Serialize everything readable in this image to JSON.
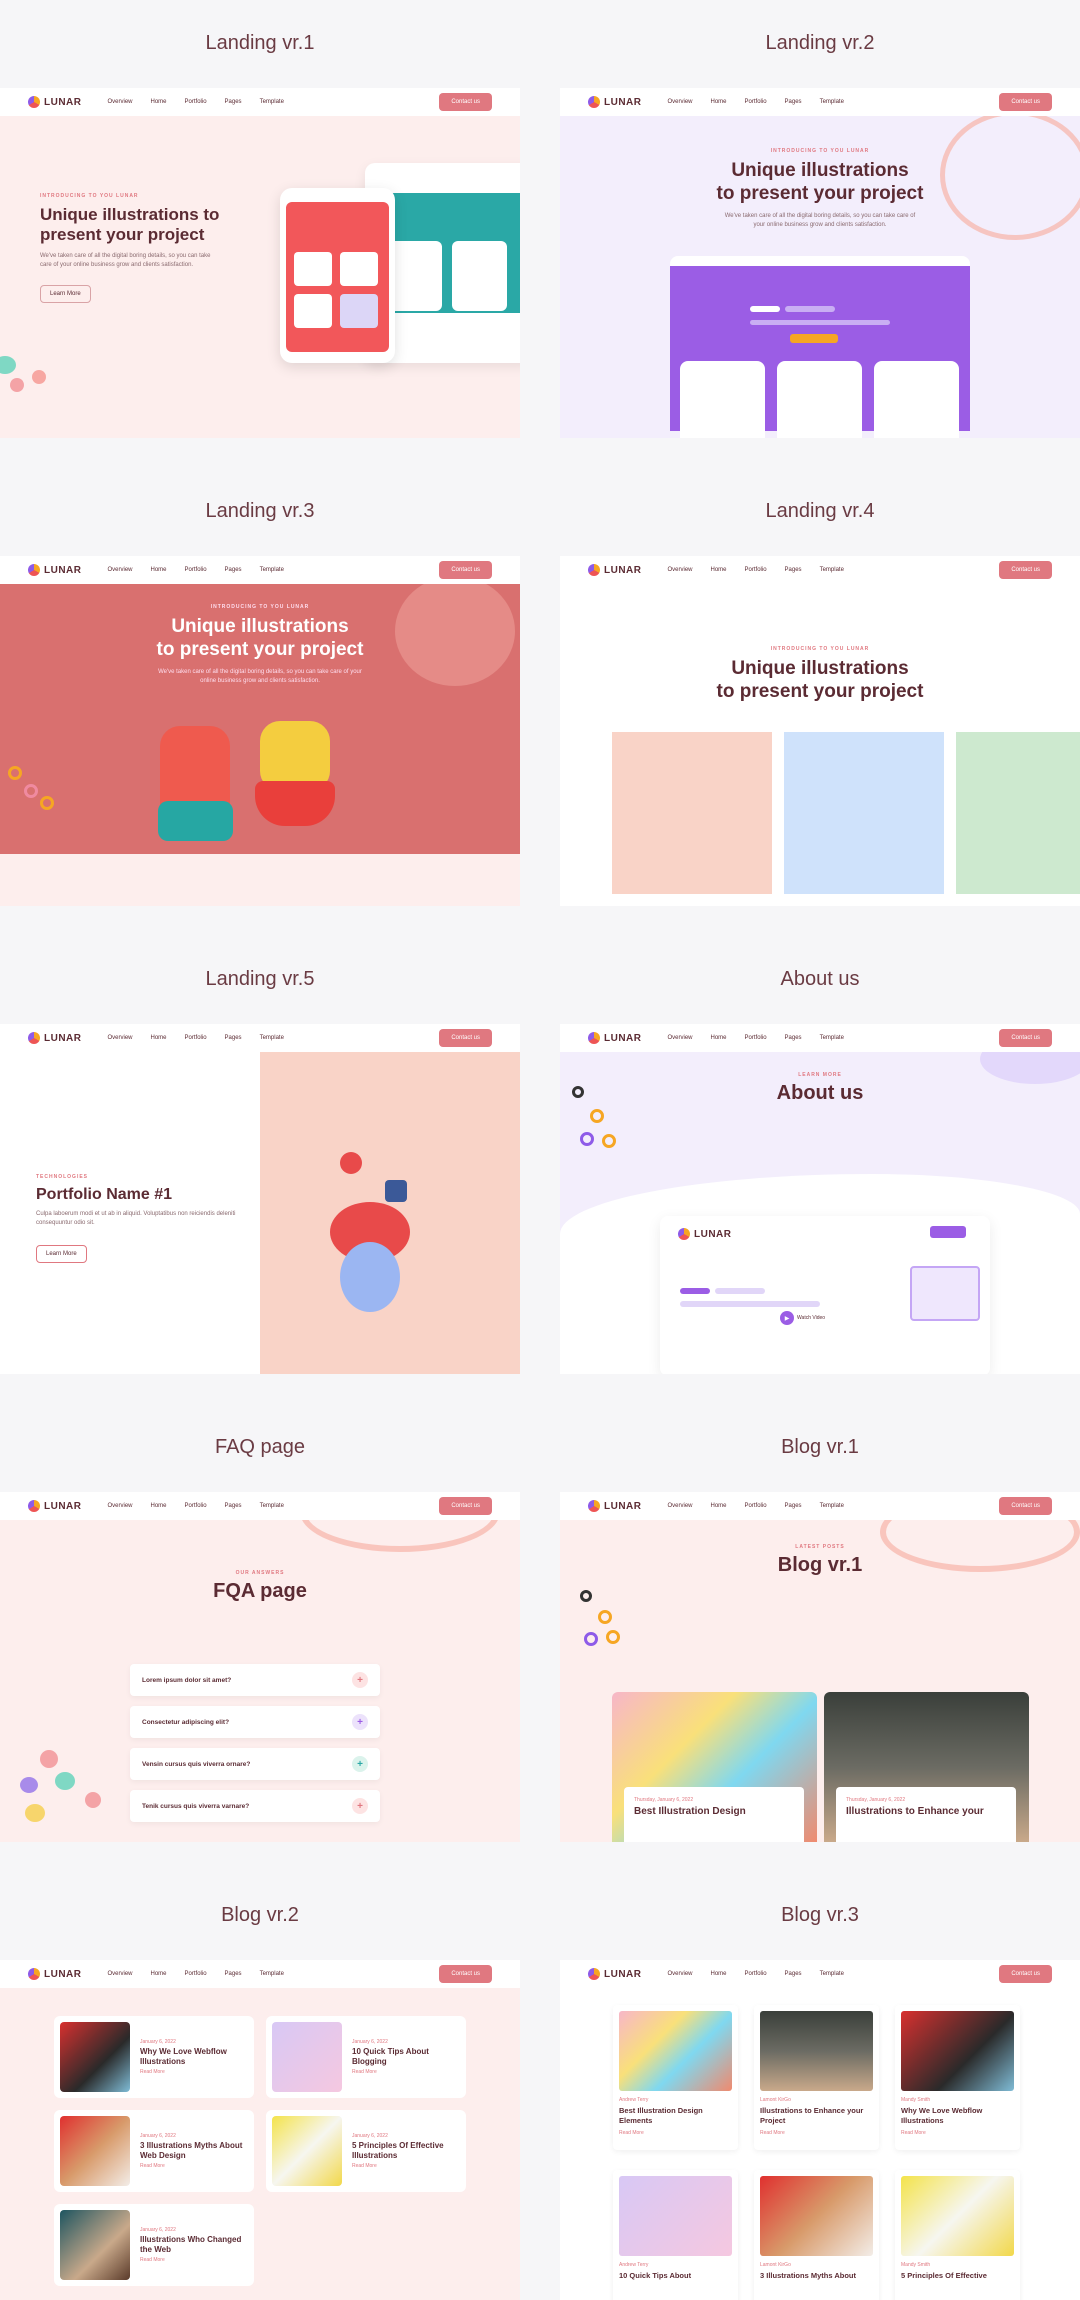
{
  "nav": {
    "logo": "LUNAR",
    "items": [
      "Overview",
      "Home",
      "Portfolio",
      "Pages",
      "Template"
    ],
    "contact": "Contact us"
  },
  "sections": [
    {
      "title": "Landing vr.1"
    },
    {
      "title": "Landing vr.2"
    },
    {
      "title": "Landing vr.3"
    },
    {
      "title": "Landing vr.4"
    },
    {
      "title": "Landing vr.5"
    },
    {
      "title": "About us"
    },
    {
      "title": "FAQ page"
    },
    {
      "title": "Blog vr.1"
    },
    {
      "title": "Blog vr.2"
    },
    {
      "title": "Blog vr.3"
    }
  ],
  "landing1": {
    "eyebrow": "INTRODUCING TO YOU LUNAR",
    "heading": "Unique illustrations to present your project",
    "text": "We've taken care of all the digital boring details, so you can take care of your online business grow and clients satisfaction.",
    "button": "Learn More"
  },
  "landing2": {
    "eyebrow": "INTRODUCING TO YOU LUNAR",
    "heading_line1": "Unique illustrations",
    "heading_line2": "to present your project",
    "text": "We've taken care of all the digital boring details, so you can take care of your online business grow and clients satisfaction."
  },
  "landing3": {
    "eyebrow": "INTRODUCING TO YOU LUNAR",
    "heading_line1": "Unique illustrations",
    "heading_line2": "to present your project",
    "text": "We've taken care of all the digital boring details, so you can take care of your online business grow and clients satisfaction."
  },
  "landing4": {
    "eyebrow": "INTRODUCING TO YOU LUNAR",
    "heading_line1": "Unique illustrations",
    "heading_line2": "to present your project"
  },
  "landing5": {
    "eyebrow": "TECHNOLOGIES",
    "heading": "Portfolio Name #1",
    "text": "Culpa laboerum modi et ut ab in aliquid. Voluptatibus non reiciendis deleniti consequuntur odio sit.",
    "button": "Learn More"
  },
  "about": {
    "eyebrow": "LEARN MORE",
    "heading": "About us",
    "watch": "Watch Video"
  },
  "faq": {
    "eyebrow": "OUR ANSWERS",
    "heading": "FQA page",
    "items": [
      "Lorem ipsum dolor sit amet?",
      "Consectetur adipiscing elit?",
      "Vensin cursus quis viverra ornare?",
      "Tenik cursus quis viverra varnare?"
    ]
  },
  "blog1": {
    "eyebrow": "LATEST POSTS",
    "heading": "Blog vr.1",
    "posts": [
      {
        "date": "Thursday, January 6, 2022",
        "title": "Best Illustration Design"
      },
      {
        "date": "Thursday, January 6, 2022",
        "title": "Illustrations to Enhance your"
      }
    ]
  },
  "blog2": {
    "posts": [
      {
        "date": "January 6, 2022",
        "title": "Why We Love Webflow Illustrations",
        "read": "Read More"
      },
      {
        "date": "January 6, 2022",
        "title": "10 Quick Tips About Blogging",
        "read": "Read More"
      },
      {
        "date": "January 6, 2022",
        "title": "3 Illustrations Myths About Web Design",
        "read": "Read More"
      },
      {
        "date": "January 6, 2022",
        "title": "5 Principles Of Effective Illustrations",
        "read": "Read More"
      },
      {
        "date": "January 6, 2022",
        "title": "Illustrations Who Changed the Web",
        "read": "Read More"
      }
    ]
  },
  "blog3": {
    "posts": [
      {
        "author": "Andrew Terry",
        "title": "Best Illustration Design Elements",
        "read": "Read More"
      },
      {
        "author": "Lamont KirGo",
        "title": "Illustrations to Enhance your Project",
        "read": "Read More"
      },
      {
        "author": "Mandy Smith",
        "title": "Why We Love Webflow Illustrations",
        "read": "Read More"
      },
      {
        "author": "Andrew Terry",
        "title": "10 Quick Tips About",
        "read": ""
      },
      {
        "author": "Lamont KirGo",
        "title": "3 Illustrations Myths About",
        "read": ""
      },
      {
        "author": "Mandy Smith",
        "title": "5 Principles Of Effective",
        "read": ""
      }
    ]
  },
  "colors": {
    "accent": "#e07880",
    "heading": "#5b2b33",
    "pink_bg": "#fdeeed",
    "lavender_bg": "#f3eefc",
    "coral_hero": "#d9706f",
    "purple": "#9b5de5"
  }
}
